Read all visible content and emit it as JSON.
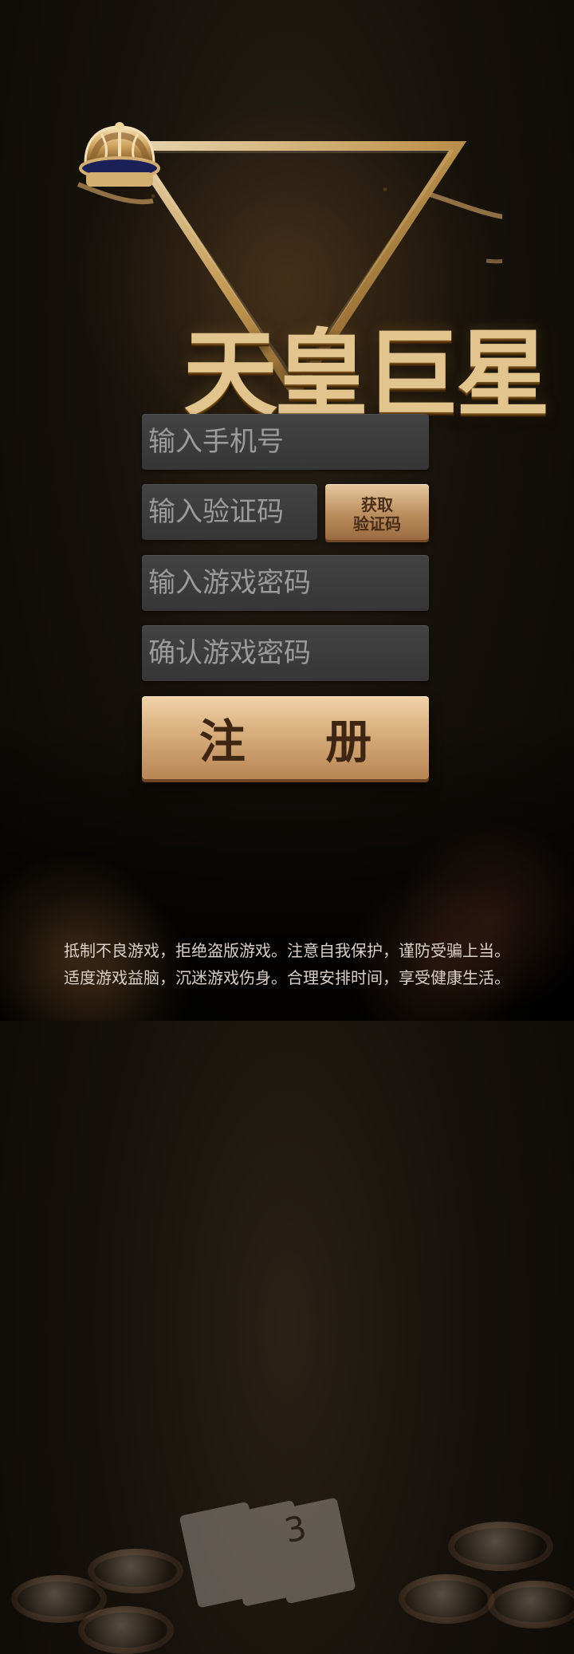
{
  "logo": {
    "text": "天皇巨星"
  },
  "form": {
    "phone_placeholder": "输入手机号",
    "code_placeholder": "输入验证码",
    "password_placeholder": "输入游戏密码",
    "confirm_password_placeholder": "确认游戏密码",
    "get_code_button_label_1": "获取",
    "get_code_button_label_2": "验证码",
    "register_button_label": "注 册"
  },
  "footer": {
    "line_1": "抵制不良游戏，拒绝盗版游戏。注意自我保护，谨防受骗上当。",
    "line_2": "适度游戏益脑，沉迷游戏伤身。合理安排时间，享受健康生活。"
  },
  "decor": {
    "card_value": "3"
  },
  "icons": {
    "crown": "crown-icon"
  },
  "colors": {
    "background": "#16110b",
    "gold": "#d5ab79",
    "input_bg": "#3d3d3d",
    "input_placeholder": "#9b9b9b",
    "notice_text": "#d9d0c8"
  }
}
